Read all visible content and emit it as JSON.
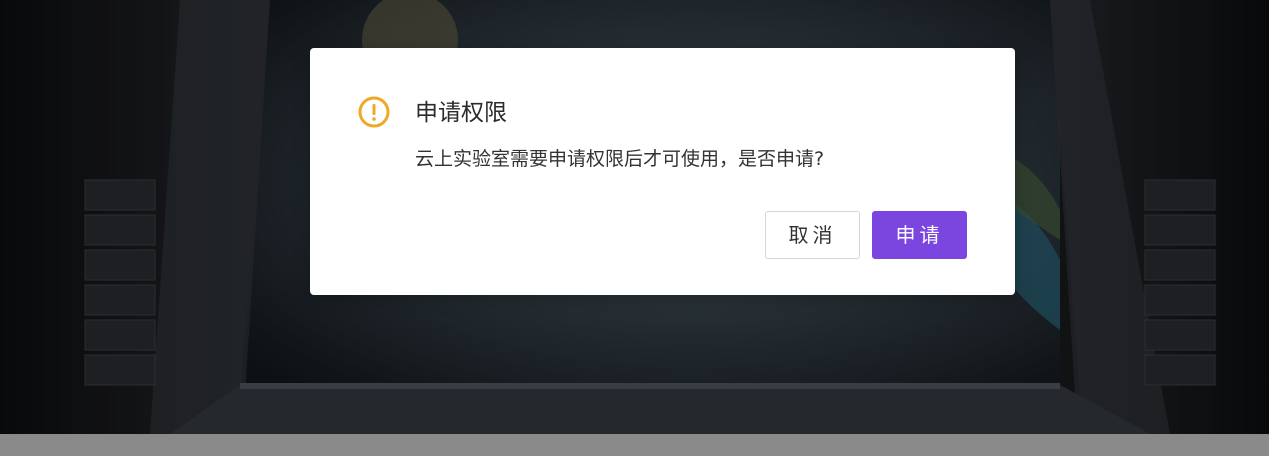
{
  "dialog": {
    "title": "申请权限",
    "message": "云上实验室需要申请权限后才可使用，是否申请?",
    "icon": "warning-icon",
    "cancel_label": "取消",
    "confirm_label": "申请"
  },
  "colors": {
    "accent": "#7b46e0",
    "warning": "#f0a828",
    "dialog_bg": "#ffffff"
  }
}
